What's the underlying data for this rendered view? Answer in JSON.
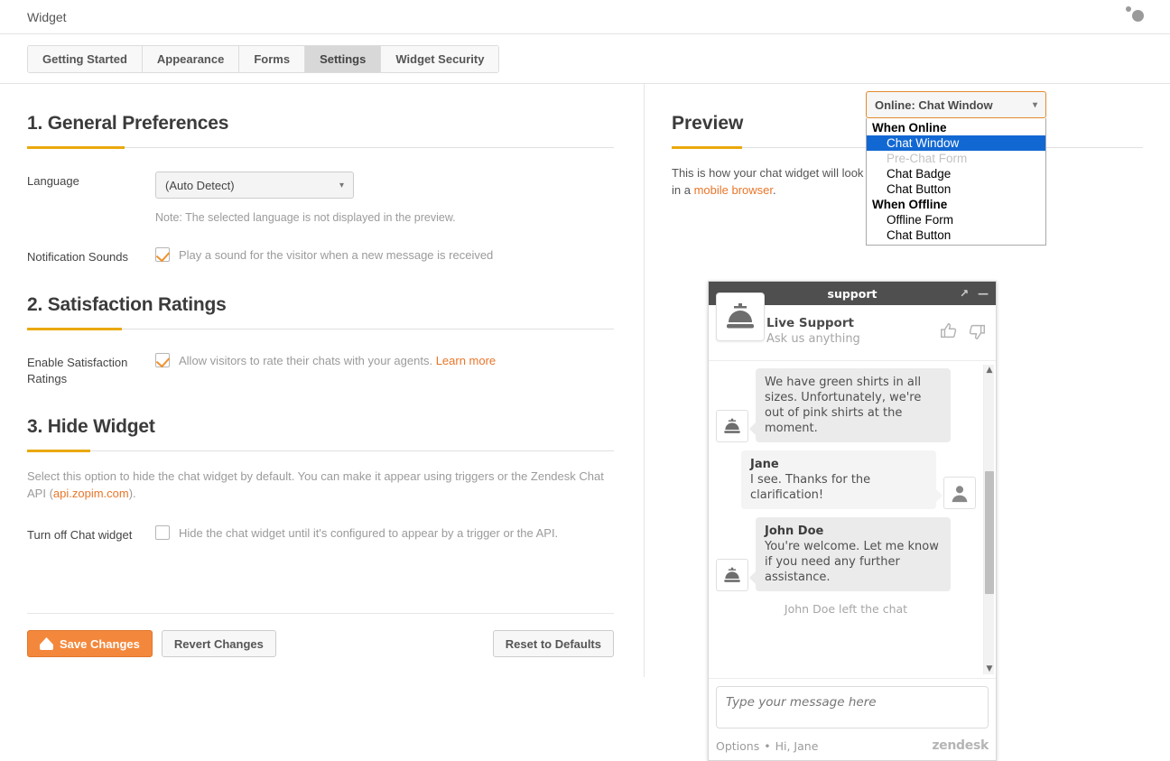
{
  "topbar": {
    "title": "Widget",
    "spinner_icon": "loading-dots-icon"
  },
  "tabs": [
    {
      "label": "Getting Started",
      "active": false
    },
    {
      "label": "Appearance",
      "active": false
    },
    {
      "label": "Forms",
      "active": false
    },
    {
      "label": "Settings",
      "active": true
    },
    {
      "label": "Widget Security",
      "active": false
    }
  ],
  "sections": {
    "general": {
      "title": "1. General Preferences",
      "language_label": "Language",
      "language_value": "(Auto Detect)",
      "language_caret_icon": "chevron-down-icon",
      "language_note": "Note: The selected language is not displayed in the preview.",
      "sounds_label": "Notification Sounds",
      "sounds_checked": true,
      "sounds_text": "Play a sound for the visitor when a new message is received"
    },
    "satisfaction": {
      "title": "2. Satisfaction Ratings",
      "label": "Enable Satisfaction Ratings",
      "checked": true,
      "text": "Allow visitors to rate their chats with your agents.",
      "link": "Learn more"
    },
    "hide": {
      "title": "3. Hide Widget",
      "desc_before": "Select this option to hide the chat widget by default. You can make it appear using triggers or the Zendesk Chat API (",
      "desc_link": "api.zopim.com",
      "desc_after": ").",
      "label": "Turn off Chat widget",
      "checked": false,
      "text": "Hide the chat widget until it's configured to appear by a trigger or the API."
    }
  },
  "buttons": {
    "save": "Save Changes",
    "save_icon": "zendesk-logo-icon",
    "revert": "Revert Changes",
    "reset": "Reset to Defaults"
  },
  "preview": {
    "title": "Preview",
    "desc_1": "This is how your chat widget will look in",
    "desc_2": "it'll look like in a ",
    "desc_link": "mobile browser",
    "desc_3": "."
  },
  "dropdown": {
    "selected": "Online: Chat Window",
    "caret_icon": "chevron-down-icon",
    "groups": [
      {
        "label": "When Online",
        "options": [
          {
            "label": "Chat Window",
            "selected": true,
            "disabled": false
          },
          {
            "label": "Pre-Chat Form",
            "selected": false,
            "disabled": true
          },
          {
            "label": "Chat Badge",
            "selected": false,
            "disabled": false
          },
          {
            "label": "Chat Button",
            "selected": false,
            "disabled": false
          }
        ]
      },
      {
        "label": "When Offline",
        "options": [
          {
            "label": "Offline Form",
            "selected": false,
            "disabled": false
          },
          {
            "label": "Chat Button",
            "selected": false,
            "disabled": false
          }
        ]
      }
    ]
  },
  "chat_widget": {
    "title_bar": "support",
    "expand_icon": "expand-arrow-icon",
    "minimize_icon": "minimize-icon",
    "agent_avatar_icon": "service-bell-icon",
    "agent_name": "Live Support",
    "agent_tagline": "Ask us anything",
    "thumb_up_icon": "thumbs-up-icon",
    "thumb_down_icon": "thumbs-down-icon",
    "messages": [
      {
        "type": "agent",
        "avatar_icon": "service-bell-icon",
        "sender": "",
        "text": "We have green shirts in all sizes. Unfortunately, we're out of pink shirts at the moment."
      },
      {
        "type": "visitor",
        "avatar_icon": "person-icon",
        "sender": "Jane",
        "text": "I see. Thanks for the clarification!"
      },
      {
        "type": "agent",
        "avatar_icon": "service-bell-icon",
        "sender": "John Doe",
        "text": "You're welcome. Let me know if you need any further assistance."
      }
    ],
    "system_message": "John Doe left the chat",
    "scroll_up_icon": "scroll-up-arrow-icon",
    "scroll_down_icon": "scroll-down-arrow-icon",
    "input_placeholder": "Type your message here",
    "options_label": "Options",
    "separator": "•",
    "greeting": "Hi, Jane",
    "brand": "zendesk"
  },
  "colors": {
    "accent_orange": "#eaa90d",
    "link_orange": "#e8762a",
    "primary_button": "#f3883c",
    "select_highlight": "#1268d3",
    "chat_bar": "#4f4f4f"
  }
}
